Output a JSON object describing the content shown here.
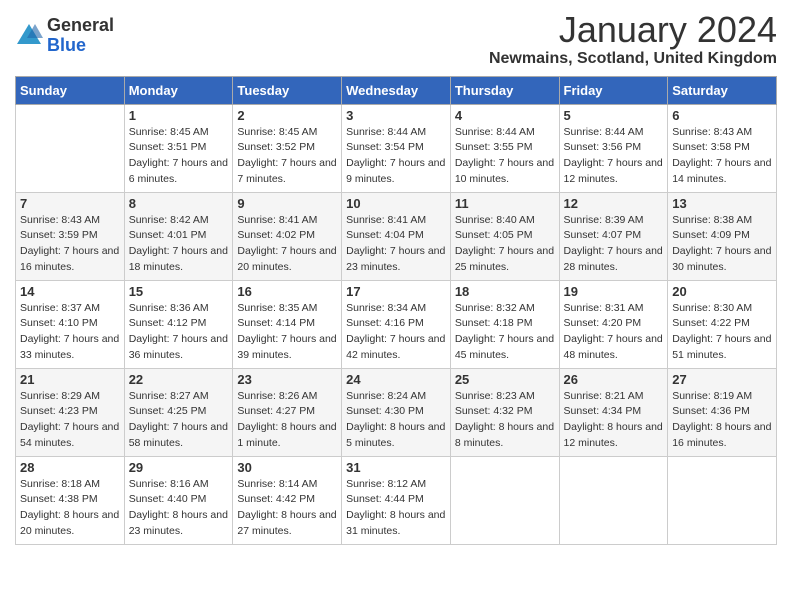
{
  "logo": {
    "general": "General",
    "blue": "Blue"
  },
  "title": "January 2024",
  "location": "Newmains, Scotland, United Kingdom",
  "days_of_week": [
    "Sunday",
    "Monday",
    "Tuesday",
    "Wednesday",
    "Thursday",
    "Friday",
    "Saturday"
  ],
  "weeks": [
    [
      {
        "day": "",
        "sunrise": "",
        "sunset": "",
        "daylight": ""
      },
      {
        "day": "1",
        "sunrise": "Sunrise: 8:45 AM",
        "sunset": "Sunset: 3:51 PM",
        "daylight": "Daylight: 7 hours and 6 minutes."
      },
      {
        "day": "2",
        "sunrise": "Sunrise: 8:45 AM",
        "sunset": "Sunset: 3:52 PM",
        "daylight": "Daylight: 7 hours and 7 minutes."
      },
      {
        "day": "3",
        "sunrise": "Sunrise: 8:44 AM",
        "sunset": "Sunset: 3:54 PM",
        "daylight": "Daylight: 7 hours and 9 minutes."
      },
      {
        "day": "4",
        "sunrise": "Sunrise: 8:44 AM",
        "sunset": "Sunset: 3:55 PM",
        "daylight": "Daylight: 7 hours and 10 minutes."
      },
      {
        "day": "5",
        "sunrise": "Sunrise: 8:44 AM",
        "sunset": "Sunset: 3:56 PM",
        "daylight": "Daylight: 7 hours and 12 minutes."
      },
      {
        "day": "6",
        "sunrise": "Sunrise: 8:43 AM",
        "sunset": "Sunset: 3:58 PM",
        "daylight": "Daylight: 7 hours and 14 minutes."
      }
    ],
    [
      {
        "day": "7",
        "sunrise": "Sunrise: 8:43 AM",
        "sunset": "Sunset: 3:59 PM",
        "daylight": "Daylight: 7 hours and 16 minutes."
      },
      {
        "day": "8",
        "sunrise": "Sunrise: 8:42 AM",
        "sunset": "Sunset: 4:01 PM",
        "daylight": "Daylight: 7 hours and 18 minutes."
      },
      {
        "day": "9",
        "sunrise": "Sunrise: 8:41 AM",
        "sunset": "Sunset: 4:02 PM",
        "daylight": "Daylight: 7 hours and 20 minutes."
      },
      {
        "day": "10",
        "sunrise": "Sunrise: 8:41 AM",
        "sunset": "Sunset: 4:04 PM",
        "daylight": "Daylight: 7 hours and 23 minutes."
      },
      {
        "day": "11",
        "sunrise": "Sunrise: 8:40 AM",
        "sunset": "Sunset: 4:05 PM",
        "daylight": "Daylight: 7 hours and 25 minutes."
      },
      {
        "day": "12",
        "sunrise": "Sunrise: 8:39 AM",
        "sunset": "Sunset: 4:07 PM",
        "daylight": "Daylight: 7 hours and 28 minutes."
      },
      {
        "day": "13",
        "sunrise": "Sunrise: 8:38 AM",
        "sunset": "Sunset: 4:09 PM",
        "daylight": "Daylight: 7 hours and 30 minutes."
      }
    ],
    [
      {
        "day": "14",
        "sunrise": "Sunrise: 8:37 AM",
        "sunset": "Sunset: 4:10 PM",
        "daylight": "Daylight: 7 hours and 33 minutes."
      },
      {
        "day": "15",
        "sunrise": "Sunrise: 8:36 AM",
        "sunset": "Sunset: 4:12 PM",
        "daylight": "Daylight: 7 hours and 36 minutes."
      },
      {
        "day": "16",
        "sunrise": "Sunrise: 8:35 AM",
        "sunset": "Sunset: 4:14 PM",
        "daylight": "Daylight: 7 hours and 39 minutes."
      },
      {
        "day": "17",
        "sunrise": "Sunrise: 8:34 AM",
        "sunset": "Sunset: 4:16 PM",
        "daylight": "Daylight: 7 hours and 42 minutes."
      },
      {
        "day": "18",
        "sunrise": "Sunrise: 8:32 AM",
        "sunset": "Sunset: 4:18 PM",
        "daylight": "Daylight: 7 hours and 45 minutes."
      },
      {
        "day": "19",
        "sunrise": "Sunrise: 8:31 AM",
        "sunset": "Sunset: 4:20 PM",
        "daylight": "Daylight: 7 hours and 48 minutes."
      },
      {
        "day": "20",
        "sunrise": "Sunrise: 8:30 AM",
        "sunset": "Sunset: 4:22 PM",
        "daylight": "Daylight: 7 hours and 51 minutes."
      }
    ],
    [
      {
        "day": "21",
        "sunrise": "Sunrise: 8:29 AM",
        "sunset": "Sunset: 4:23 PM",
        "daylight": "Daylight: 7 hours and 54 minutes."
      },
      {
        "day": "22",
        "sunrise": "Sunrise: 8:27 AM",
        "sunset": "Sunset: 4:25 PM",
        "daylight": "Daylight: 7 hours and 58 minutes."
      },
      {
        "day": "23",
        "sunrise": "Sunrise: 8:26 AM",
        "sunset": "Sunset: 4:27 PM",
        "daylight": "Daylight: 8 hours and 1 minute."
      },
      {
        "day": "24",
        "sunrise": "Sunrise: 8:24 AM",
        "sunset": "Sunset: 4:30 PM",
        "daylight": "Daylight: 8 hours and 5 minutes."
      },
      {
        "day": "25",
        "sunrise": "Sunrise: 8:23 AM",
        "sunset": "Sunset: 4:32 PM",
        "daylight": "Daylight: 8 hours and 8 minutes."
      },
      {
        "day": "26",
        "sunrise": "Sunrise: 8:21 AM",
        "sunset": "Sunset: 4:34 PM",
        "daylight": "Daylight: 8 hours and 12 minutes."
      },
      {
        "day": "27",
        "sunrise": "Sunrise: 8:19 AM",
        "sunset": "Sunset: 4:36 PM",
        "daylight": "Daylight: 8 hours and 16 minutes."
      }
    ],
    [
      {
        "day": "28",
        "sunrise": "Sunrise: 8:18 AM",
        "sunset": "Sunset: 4:38 PM",
        "daylight": "Daylight: 8 hours and 20 minutes."
      },
      {
        "day": "29",
        "sunrise": "Sunrise: 8:16 AM",
        "sunset": "Sunset: 4:40 PM",
        "daylight": "Daylight: 8 hours and 23 minutes."
      },
      {
        "day": "30",
        "sunrise": "Sunrise: 8:14 AM",
        "sunset": "Sunset: 4:42 PM",
        "daylight": "Daylight: 8 hours and 27 minutes."
      },
      {
        "day": "31",
        "sunrise": "Sunrise: 8:12 AM",
        "sunset": "Sunset: 4:44 PM",
        "daylight": "Daylight: 8 hours and 31 minutes."
      },
      {
        "day": "",
        "sunrise": "",
        "sunset": "",
        "daylight": ""
      },
      {
        "day": "",
        "sunrise": "",
        "sunset": "",
        "daylight": ""
      },
      {
        "day": "",
        "sunrise": "",
        "sunset": "",
        "daylight": ""
      }
    ]
  ]
}
